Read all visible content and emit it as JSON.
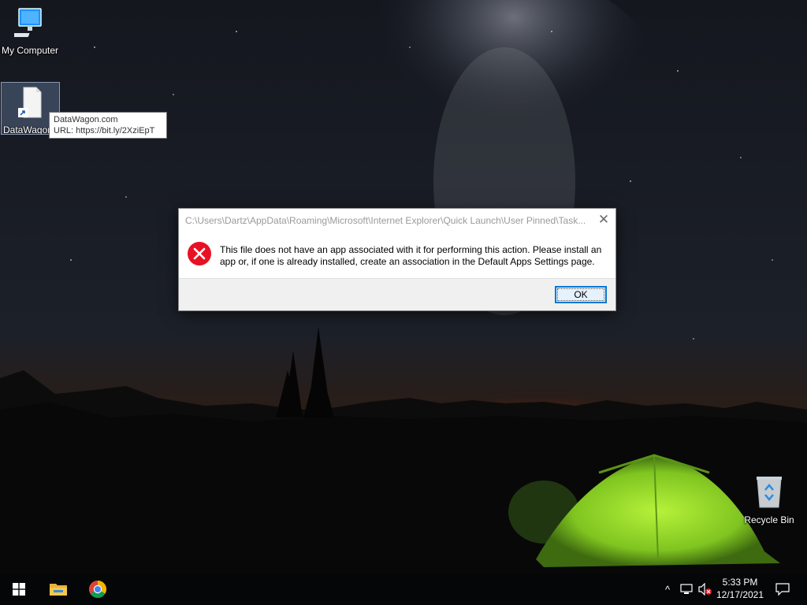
{
  "desktop": {
    "icons": [
      {
        "label": "My Computer"
      },
      {
        "label": "DataWagon.com"
      },
      {
        "label": "Recycle Bin"
      }
    ],
    "tooltip": {
      "line1": "DataWagon.com",
      "line2": "URL: https://bit.ly/2XziEpT"
    }
  },
  "dialog": {
    "title": "C:\\Users\\Dartz\\AppData\\Roaming\\Microsoft\\Internet Explorer\\Quick Launch\\User Pinned\\Task...",
    "close_label": "✕",
    "icon": "error-icon",
    "message": "This file does not have an app associated with it for performing this action. Please install an app or, if one is already installed, create an association in the Default Apps Settings page.",
    "ok_label": "OK"
  },
  "taskbar": {
    "start_icon": "windows-logo-icon",
    "pinned": [
      {
        "icon": "file-explorer-icon"
      },
      {
        "icon": "chrome-icon"
      }
    ],
    "tray": {
      "chevron": "^",
      "network_icon": "network-icon",
      "volume_icon": "volume-muted-icon"
    },
    "clock": {
      "time": "5:33 PM",
      "date": "12/17/2021"
    },
    "notification_icon": "action-center-icon"
  },
  "colors": {
    "accent": "#0078d7",
    "error_red": "#e81123",
    "tent_green": "#8ad82a"
  }
}
